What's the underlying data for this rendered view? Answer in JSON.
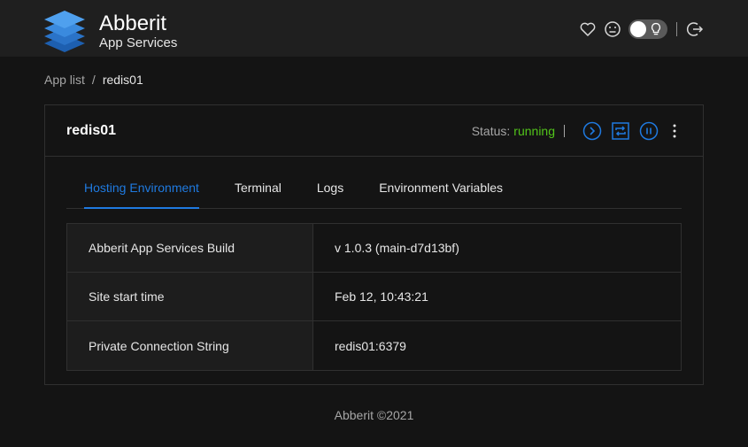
{
  "header": {
    "brand_name": "Abberit",
    "brand_sub": "App Services",
    "icons": [
      "heart-icon",
      "face-icon",
      "theme-toggle",
      "logout-icon"
    ]
  },
  "breadcrumb": {
    "root": "App list",
    "separator": "/",
    "current": "redis01"
  },
  "app": {
    "name": "redis01",
    "status_label": "Status:",
    "status_value": "running",
    "actions": [
      "play-icon",
      "restart-icon",
      "pause-icon",
      "more-icon"
    ]
  },
  "tabs": [
    {
      "label": "Hosting Environment",
      "active": true
    },
    {
      "label": "Terminal",
      "active": false
    },
    {
      "label": "Logs",
      "active": false
    },
    {
      "label": "Environment Variables",
      "active": false
    }
  ],
  "info": [
    {
      "key": "Abberit App Services Build",
      "value": "v 1.0.3 (main-d7d13bf)"
    },
    {
      "key": "Site start time",
      "value": "Feb 12, 10:43:21"
    },
    {
      "key": "Private Connection String",
      "value": "redis01:6379"
    }
  ],
  "footer": {
    "text": "Abberit ©2021"
  },
  "colors": {
    "accent": "#1f7ae0",
    "running": "#52c41a",
    "background": "#141414",
    "topbar": "#1f1f1f"
  }
}
